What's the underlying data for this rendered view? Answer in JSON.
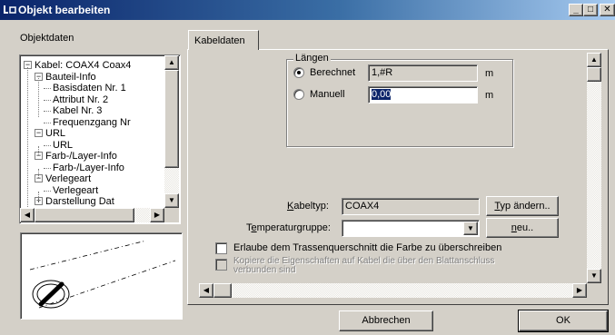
{
  "window": {
    "title": "Objekt bearbeiten",
    "icon": "objekt-icon"
  },
  "title_buttons": [
    "minimize-icon",
    "maximize-icon",
    "close-icon"
  ],
  "left": {
    "section_label": "Objektdaten",
    "tree": [
      {
        "label": "Kabel: COAX4 Coax4",
        "level": 0,
        "expander": "-"
      },
      {
        "label": "Bauteil-Info",
        "level": 1,
        "expander": "-"
      },
      {
        "label": "Basisdaten Nr. 1",
        "level": 2
      },
      {
        "label": "Attribut Nr. 2",
        "level": 2
      },
      {
        "label": "Kabel  Nr. 3",
        "level": 2
      },
      {
        "label": "Frequenzgang Nr",
        "level": 2
      },
      {
        "label": "URL",
        "level": 1,
        "expander": "-"
      },
      {
        "label": "URL",
        "level": 2
      },
      {
        "label": "Farb-/Layer-Info",
        "level": 1,
        "expander": "-"
      },
      {
        "label": "Farb-/Layer-Info",
        "level": 2
      },
      {
        "label": "Verlegeart",
        "level": 1,
        "expander": "-"
      },
      {
        "label": "Verlegeart",
        "level": 2
      },
      {
        "label": "Darstellung Dat",
        "level": 1,
        "expander": "+"
      }
    ]
  },
  "tab": {
    "label": "Kabeldaten"
  },
  "laengen": {
    "group_label": "Längen",
    "berechnet_label": "Berechnet",
    "berechnet_value": "1,#R",
    "manuell_label": "Manuell",
    "manuell_value": "0,00",
    "unit": "m",
    "selected": "berechnet"
  },
  "kabeltyp": {
    "label_first": "K",
    "label_rest": "abeltyp:",
    "value": "COAX4",
    "button_first": "T",
    "button_rest": "yp ändern.."
  },
  "temperatur": {
    "label_pre": "T",
    "label_u": "e",
    "label_post": "mperaturgruppe:",
    "value": "",
    "button_u": "n",
    "button_rest": "eu.."
  },
  "checkbox1": {
    "label": "Erlaube dem Trassenquerschnitt die Farbe zu überschreiben",
    "checked": false
  },
  "checkbox2": {
    "label_line1": "Kopiere die Eigenschaften auf Kabel die über den Blattanschluss",
    "label_line2": "verbunden sind",
    "checked": false,
    "enabled": false
  },
  "buttons": {
    "cancel": "Abbrechen",
    "ok": "OK"
  }
}
